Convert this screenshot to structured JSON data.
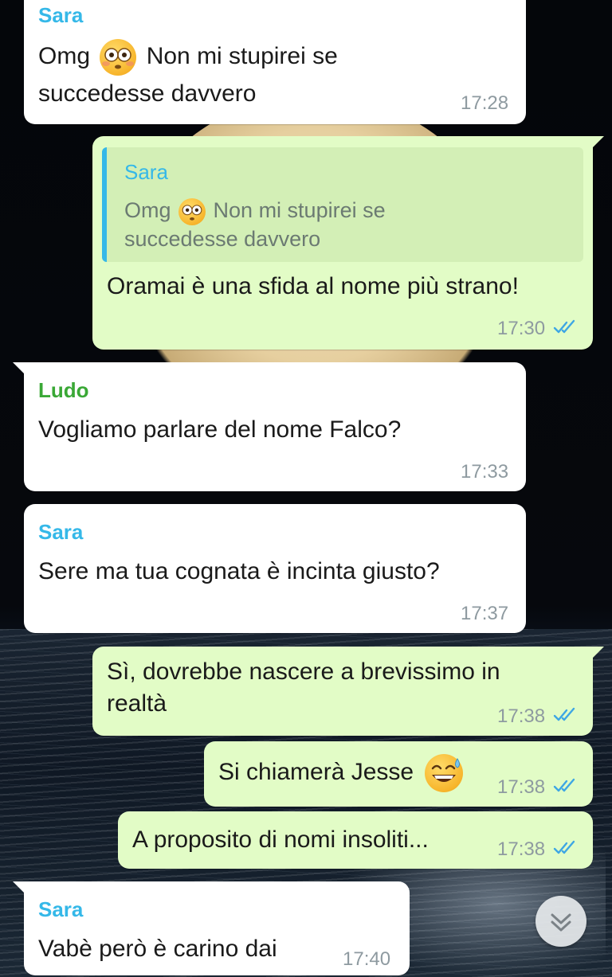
{
  "messages": [
    {
      "sender": "Sara",
      "text_before": "Omg",
      "emoji": "flushed-face-emoji",
      "text_after": " Non mi stupirei se",
      "text_line2": "succedesse davvero",
      "time": "17:28",
      "direction": "incoming"
    },
    {
      "quote": {
        "sender": "Sara",
        "text_before": "Omg",
        "emoji": "flushed-face-emoji",
        "text_after": " Non mi stupirei se",
        "text_line2": "succedesse davvero"
      },
      "text": "Oramai è una sfida al nome più strano!",
      "time": "17:30",
      "direction": "outgoing",
      "status": "read"
    },
    {
      "sender": "Ludo",
      "text": "Vogliamo parlare del nome Falco?",
      "time": "17:33",
      "direction": "incoming"
    },
    {
      "sender": "Sara",
      "text": "Sere ma tua cognata è incinta giusto?",
      "time": "17:37",
      "direction": "incoming"
    },
    {
      "text_line1": "Sì, dovrebbe nascere a brevissimo in",
      "text_line2": "realtà",
      "time": "17:38",
      "direction": "outgoing",
      "status": "read"
    },
    {
      "text": "Si chiamerà Jesse",
      "emoji": "grinning-sweat-emoji",
      "time": "17:38",
      "direction": "outgoing",
      "status": "read"
    },
    {
      "text": "A proposito di nomi insoliti...",
      "time": "17:38",
      "direction": "outgoing",
      "status": "read"
    },
    {
      "sender": "Sara",
      "text": "Vabè però è carino dai",
      "time": "17:40",
      "direction": "incoming"
    }
  ],
  "colors": {
    "incoming_bubble": "#ffffff",
    "outgoing_bubble": "#e2fcc6",
    "sender_sara": "#35b8e8",
    "sender_ludo": "#3aa836",
    "read_ticks": "#3ea6e4",
    "timestamp": "#8e9aa0"
  },
  "scroll_button": {
    "icon": "double-chevron-down-icon"
  }
}
